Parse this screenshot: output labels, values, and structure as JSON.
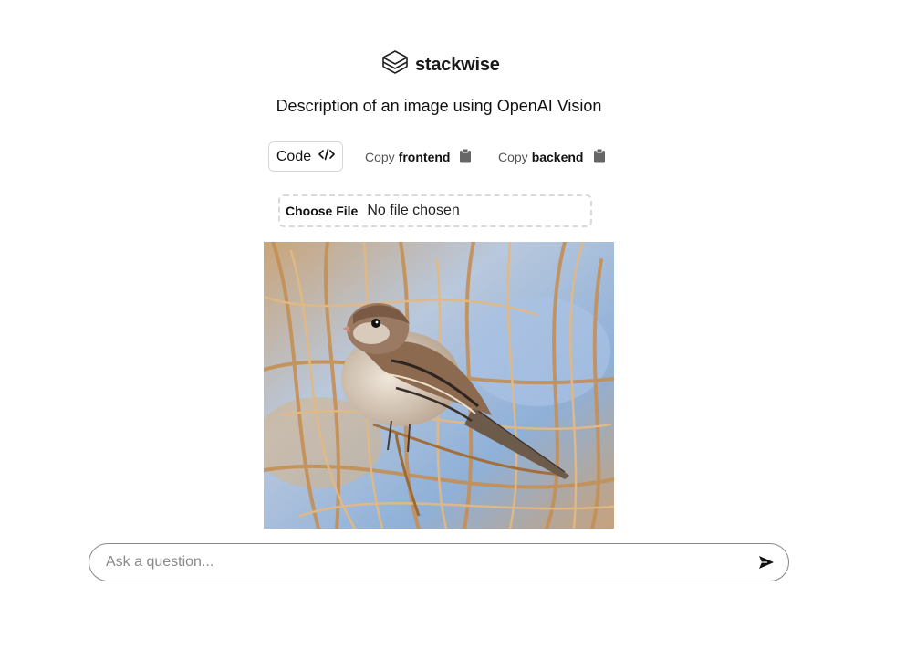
{
  "brand": {
    "name": "stackwise",
    "icon": "stack-layers-icon"
  },
  "title": "Description of an image using OpenAI Vision",
  "toolbar": {
    "code_label": "Code",
    "code_icon": "code-icon",
    "copy_frontend": {
      "prefix": "Copy",
      "target": "frontend",
      "icon": "clipboard-icon"
    },
    "copy_backend": {
      "prefix": "Copy",
      "target": "backend",
      "icon": "clipboard-icon"
    }
  },
  "file_input": {
    "button_label": "Choose File",
    "status": "No file chosen"
  },
  "image": {
    "subject": "sparrow perched on dry grass stems",
    "icon": "preview-image"
  },
  "question": {
    "placeholder": "Ask a question...",
    "value": "",
    "send_icon": "send-icon"
  },
  "colors": {
    "accent": "#111111",
    "border": "#d7d7d7",
    "muted": "#8a8a8a"
  }
}
